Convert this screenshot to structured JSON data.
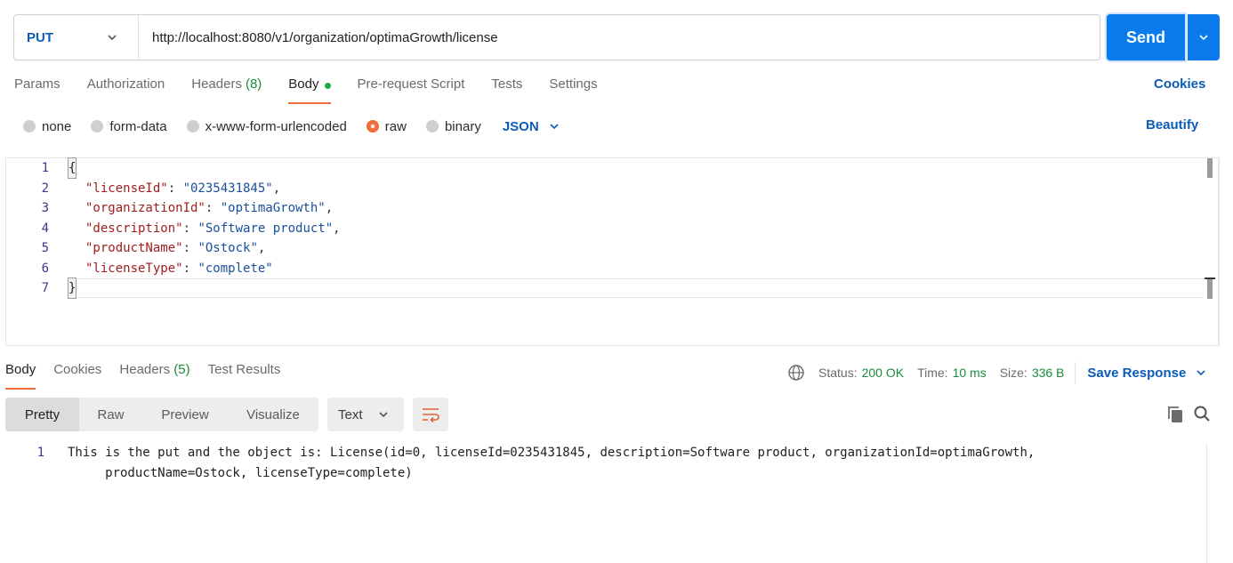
{
  "request": {
    "method": "PUT",
    "url": "http://localhost:8080/v1/organization/optimaGrowth/license",
    "send_label": "Send"
  },
  "request_tabs": [
    {
      "label": "Params"
    },
    {
      "label": "Authorization"
    },
    {
      "label": "Headers",
      "count": "(8)"
    },
    {
      "label": "Body",
      "active": true
    },
    {
      "label": "Pre-request Script"
    },
    {
      "label": "Tests"
    },
    {
      "label": "Settings"
    }
  ],
  "cookies_label": "Cookies",
  "body_types": [
    "none",
    "form-data",
    "x-www-form-urlencoded",
    "raw",
    "binary"
  ],
  "body_language": "JSON",
  "beautify_label": "Beautify",
  "editor": {
    "line_numbers": [
      "1",
      "2",
      "3",
      "4",
      "5",
      "6",
      "7"
    ],
    "open_brace": "{",
    "close_brace": "}",
    "fields": [
      {
        "key": "\"licenseId\"",
        "value": "\"0235431845\"",
        "trail": ","
      },
      {
        "key": "\"organizationId\"",
        "value": "\"optimaGrowth\"",
        "trail": ","
      },
      {
        "key": "\"description\"",
        "value": "\"Software product\"",
        "trail": ","
      },
      {
        "key": "\"productName\"",
        "value": "\"Ostock\"",
        "trail": ","
      },
      {
        "key": "\"licenseType\"",
        "value": "\"complete\"",
        "trail": ""
      }
    ]
  },
  "response_tabs": [
    {
      "label": "Body",
      "active": true
    },
    {
      "label": "Cookies"
    },
    {
      "label": "Headers",
      "count": "(5)"
    },
    {
      "label": "Test Results"
    }
  ],
  "response_status": {
    "status_label": "Status:",
    "status_value": "200 OK",
    "time_label": "Time:",
    "time_value": "10 ms",
    "size_label": "Size:",
    "size_value": "336 B",
    "save_label": "Save Response"
  },
  "view_modes": [
    "Pretty",
    "Raw",
    "Preview",
    "Visualize"
  ],
  "format": "Text",
  "response_body": {
    "line_number": "1",
    "line1": "This is the put and the object is: License(id=0, licenseId=0235431845, description=Software product, organizationId=optimaGrowth,",
    "line2": "     productName=Ostock, licenseType=complete)"
  },
  "colors": {
    "accent": "#097bed",
    "link": "#0b5cb7",
    "active_tab": "#f26b3a",
    "success": "#1b8a3c"
  }
}
